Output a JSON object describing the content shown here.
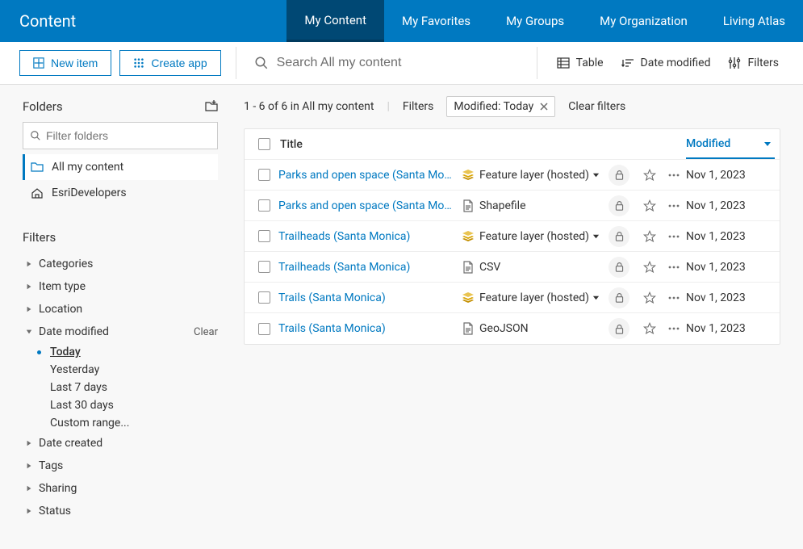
{
  "header": {
    "title": "Content",
    "tabs": [
      {
        "label": "My Content",
        "active": true
      },
      {
        "label": "My Favorites",
        "active": false
      },
      {
        "label": "My Groups",
        "active": false
      },
      {
        "label": "My Organization",
        "active": false
      },
      {
        "label": "Living Atlas",
        "active": false
      }
    ]
  },
  "actions": {
    "new_item": "New item",
    "create_app": "Create app"
  },
  "search": {
    "placeholder": "Search All my content"
  },
  "tools": {
    "view_mode": "Table",
    "sort": "Date modified",
    "filters_label": "Filters"
  },
  "folders": {
    "section_label": "Folders",
    "filter_placeholder": "Filter folders",
    "items": [
      {
        "label": "All my content",
        "active": true,
        "icon": "folder"
      },
      {
        "label": "EsriDevelopers",
        "active": false,
        "icon": "home"
      }
    ]
  },
  "filters": {
    "section_label": "Filters",
    "facets": [
      {
        "label": "Categories",
        "expanded": false
      },
      {
        "label": "Item type",
        "expanded": false
      },
      {
        "label": "Location",
        "expanded": false
      },
      {
        "label": "Date modified",
        "expanded": true,
        "clear": "Clear",
        "options": [
          {
            "label": "Today",
            "selected": true
          },
          {
            "label": "Yesterday",
            "selected": false
          },
          {
            "label": "Last 7 days",
            "selected": false
          },
          {
            "label": "Last 30 days",
            "selected": false
          },
          {
            "label": "Custom range...",
            "selected": false
          }
        ]
      },
      {
        "label": "Date created",
        "expanded": false
      },
      {
        "label": "Tags",
        "expanded": false
      },
      {
        "label": "Sharing",
        "expanded": false
      },
      {
        "label": "Status",
        "expanded": false
      }
    ]
  },
  "results": {
    "range_text": "1 - 6 of 6 in All my content",
    "filter_label": "Filters",
    "active_filter_chip": "Modified: Today",
    "clear_filters": "Clear filters",
    "columns": {
      "title": "Title",
      "modified": "Modified"
    },
    "rows": [
      {
        "title": "Parks and open space (Santa Monica)",
        "type": "Feature layer (hosted)",
        "type_icon": "layer",
        "has_caret": true,
        "modified": "Nov 1, 2023"
      },
      {
        "title": "Parks and open space (Santa Monica)",
        "type": "Shapefile",
        "type_icon": "file",
        "has_caret": false,
        "modified": "Nov 1, 2023"
      },
      {
        "title": "Trailheads (Santa Monica)",
        "type": "Feature layer (hosted)",
        "type_icon": "layer",
        "has_caret": true,
        "modified": "Nov 1, 2023"
      },
      {
        "title": "Trailheads (Santa Monica)",
        "type": "CSV",
        "type_icon": "file",
        "has_caret": false,
        "modified": "Nov 1, 2023"
      },
      {
        "title": "Trails (Santa Monica)",
        "type": "Feature layer (hosted)",
        "type_icon": "layer",
        "has_caret": true,
        "modified": "Nov 1, 2023"
      },
      {
        "title": "Trails (Santa Monica)",
        "type": "GeoJSON",
        "type_icon": "file",
        "has_caret": false,
        "modified": "Nov 1, 2023"
      }
    ]
  }
}
